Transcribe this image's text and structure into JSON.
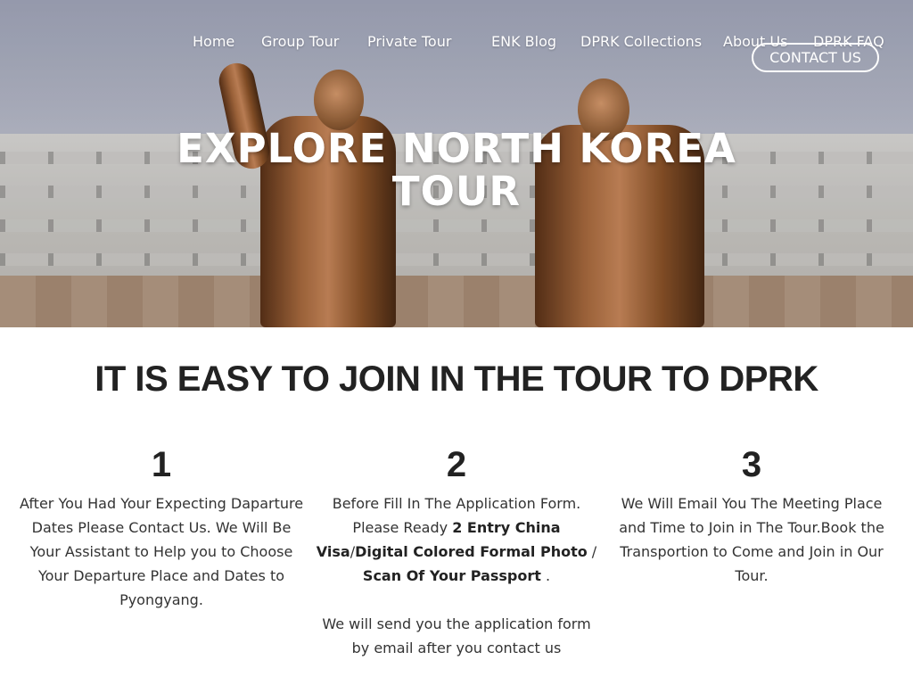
{
  "nav": {
    "items": [
      "Home",
      "Group Tour",
      "Private Tour",
      "ENK Blog",
      "DPRK Collections",
      "About Us",
      "DPRK FAQ"
    ],
    "contact_label": "CONTACT US"
  },
  "hero": {
    "title_line1": "EXPLORE NORTH KOREA",
    "title_line2": "TOUR"
  },
  "section": {
    "title": "IT IS EASY TO JOIN IN THE TOUR TO DPRK"
  },
  "steps": [
    {
      "number": "1",
      "text": "After You Had Your Expecting Daparture Dates Please Contact Us. We Will Be Your Assistant to Help you to Choose Your Departure Place and Dates to Pyongyang."
    },
    {
      "number": "2",
      "text_a": "Before Fill In The Application Form.",
      "text_b": "Please Ready ",
      "bold_1": "2 Entry China Visa",
      "sep_1": "/",
      "bold_2": "Digital Colored Formal Photo",
      "sep_2": " / ",
      "bold_3": "Scan Of Your Passport",
      "text_c": " .",
      "note": "We will send you the application form by email after you contact us"
    },
    {
      "number": "3",
      "text": "We Will Email You The Meeting Place and Time to Join  in The Tour.Book the Transportion to Come and Join in Our Tour."
    }
  ]
}
